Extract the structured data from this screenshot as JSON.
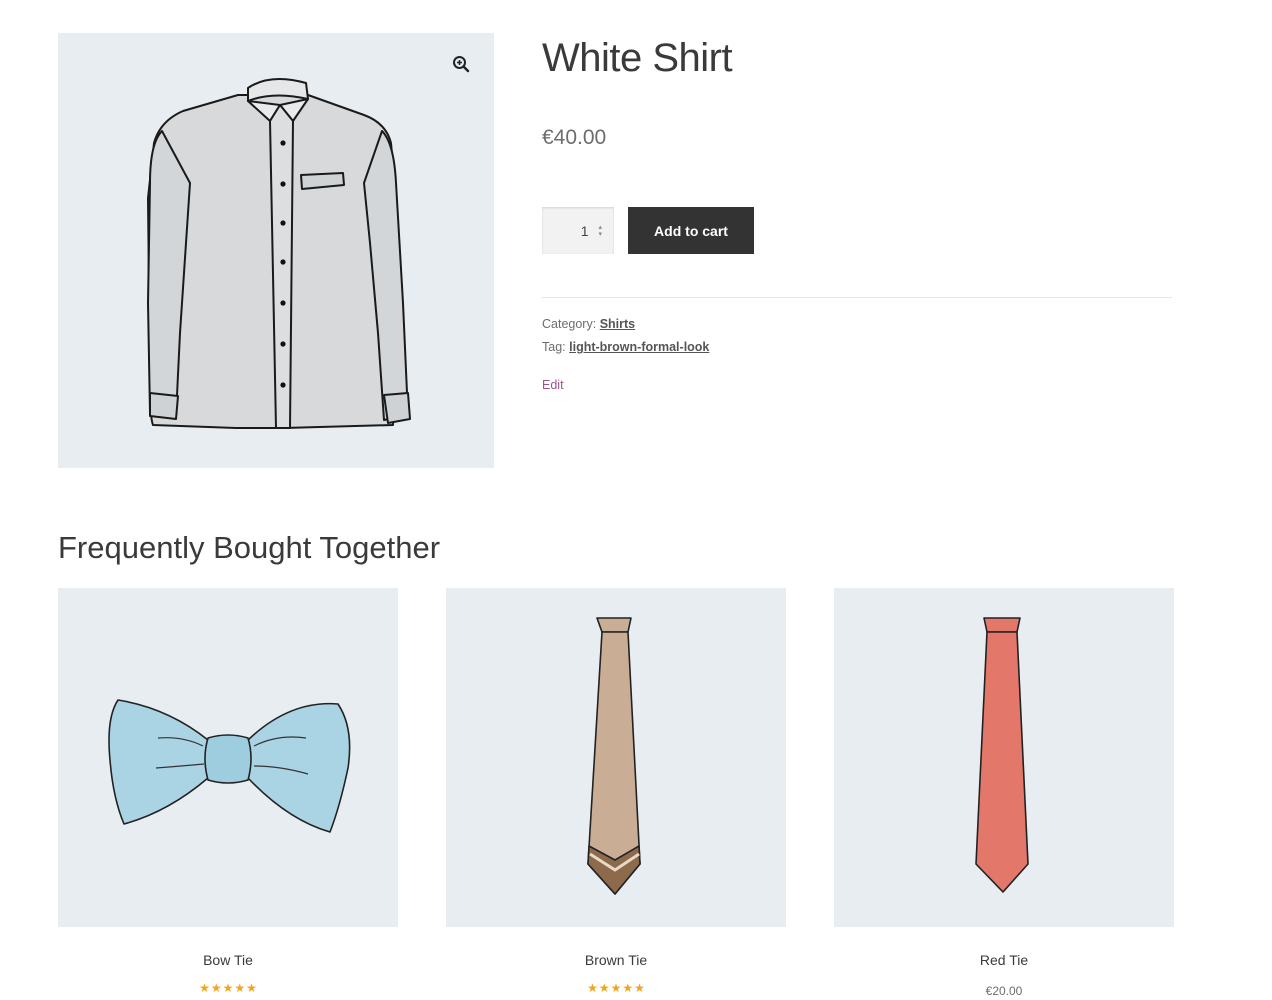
{
  "product": {
    "title": "White Shirt",
    "price": "€40.00",
    "quantity": "1",
    "add_to_cart_label": "Add to cart",
    "category_label": "Category:",
    "category_value": "Shirts",
    "tag_label": "Tag:",
    "tag_value": "light-brown-formal-look",
    "edit_label": "Edit",
    "zoom_icon": "magnifier-plus-icon"
  },
  "related": {
    "title": "Frequently Bought Together",
    "items": [
      {
        "name": "Bow Tie",
        "rating": 5,
        "image": "bow-tie-illustration"
      },
      {
        "name": "Brown Tie",
        "rating": 5,
        "image": "brown-tie-illustration"
      },
      {
        "name": "Red Tie",
        "price": "€20.00",
        "image": "red-tie-illustration"
      }
    ]
  },
  "colors": {
    "image_background": "#e8edf2",
    "button_background": "#333333",
    "edit_link": "#96588a",
    "star": "#f2a41b",
    "bow_tie": "#aad4e4",
    "brown_tie": "#c9ad94",
    "red_tie": "#e3786a"
  }
}
